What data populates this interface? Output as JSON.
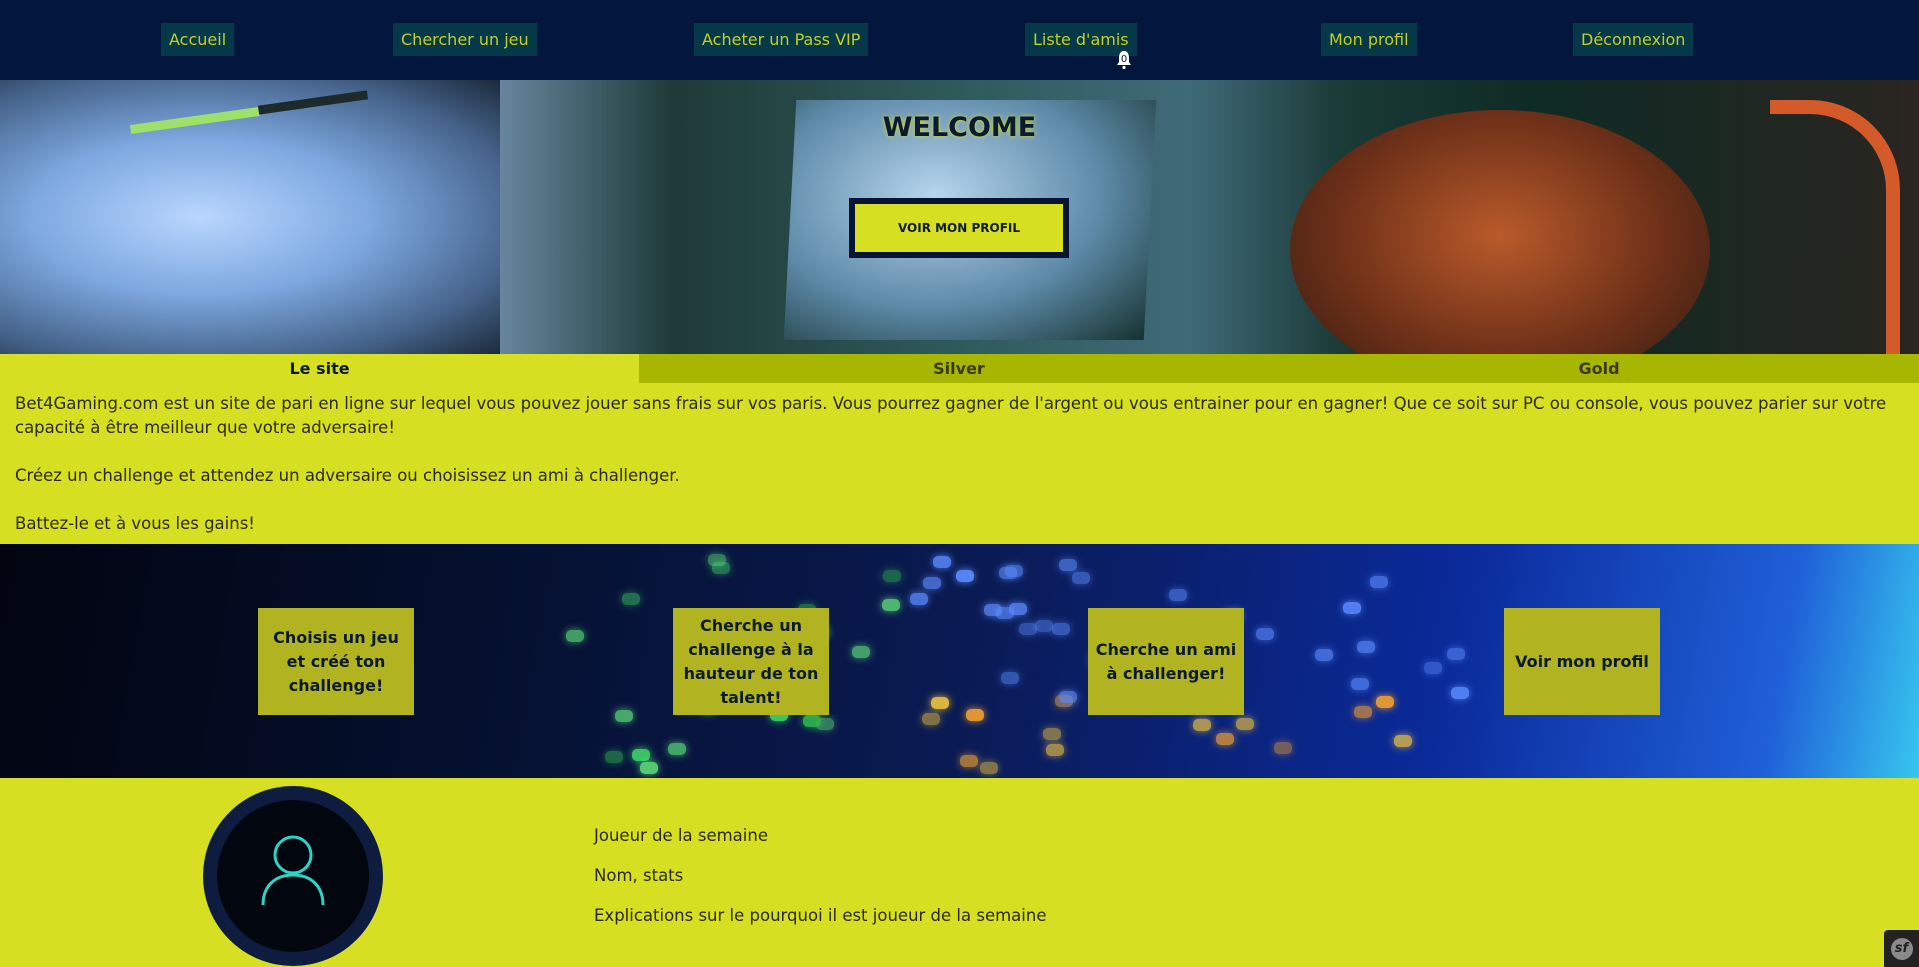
{
  "nav": {
    "items": [
      {
        "label": "Accueil"
      },
      {
        "label": "Chercher un jeu"
      },
      {
        "label": "Acheter un Pass VIP"
      },
      {
        "label": "Liste d'amis"
      },
      {
        "label": "Mon profil"
      },
      {
        "label": "Déconnexion"
      }
    ],
    "notification_count": "0"
  },
  "hero": {
    "title": "WELCOME",
    "button_label": "VOIR MON PROFIL"
  },
  "tabs": [
    {
      "label": "Le site",
      "active": true
    },
    {
      "label": "Silver",
      "active": false
    },
    {
      "label": "Gold",
      "active": false
    }
  ],
  "content": {
    "paragraphs": [
      "Bet4Gaming.com est un site de pari en ligne sur lequel vous pouvez jouer sans frais sur vos paris. Vous pourrez gagner de l'argent ou vous entrainer pour en gagner! Que ce soit sur PC ou console, vous pouvez parier sur votre capacité à être meilleur que votre adversaire!",
      "Créez un challenge et attendez un adversaire ou choisissez un ami à challenger.",
      "Battez-le et à vous les gains!"
    ]
  },
  "features": [
    {
      "label": "Choisis un jeu et créé ton challenge!"
    },
    {
      "label": "Cherche un challenge à la hauteur de ton talent!"
    },
    {
      "label": "Cherche un ami à challenger!"
    },
    {
      "label": "Voir mon profil"
    }
  ],
  "player_of_week": {
    "title": "Joueur de la semaine",
    "stats": "Nom, stats",
    "explanation": "Explications sur le pourquoi il est joueur de la semaine",
    "avatar_icon": "user-icon"
  },
  "debug_toolbar_icon": "symfony-icon",
  "colors": {
    "nav_bg": "#03163d",
    "nav_button_bg": "#05394a",
    "accent": "#d6df22",
    "tab_inactive": "#a7b600",
    "card_bg": "#b1b321",
    "avatar_stroke": "#2fd3c5"
  }
}
